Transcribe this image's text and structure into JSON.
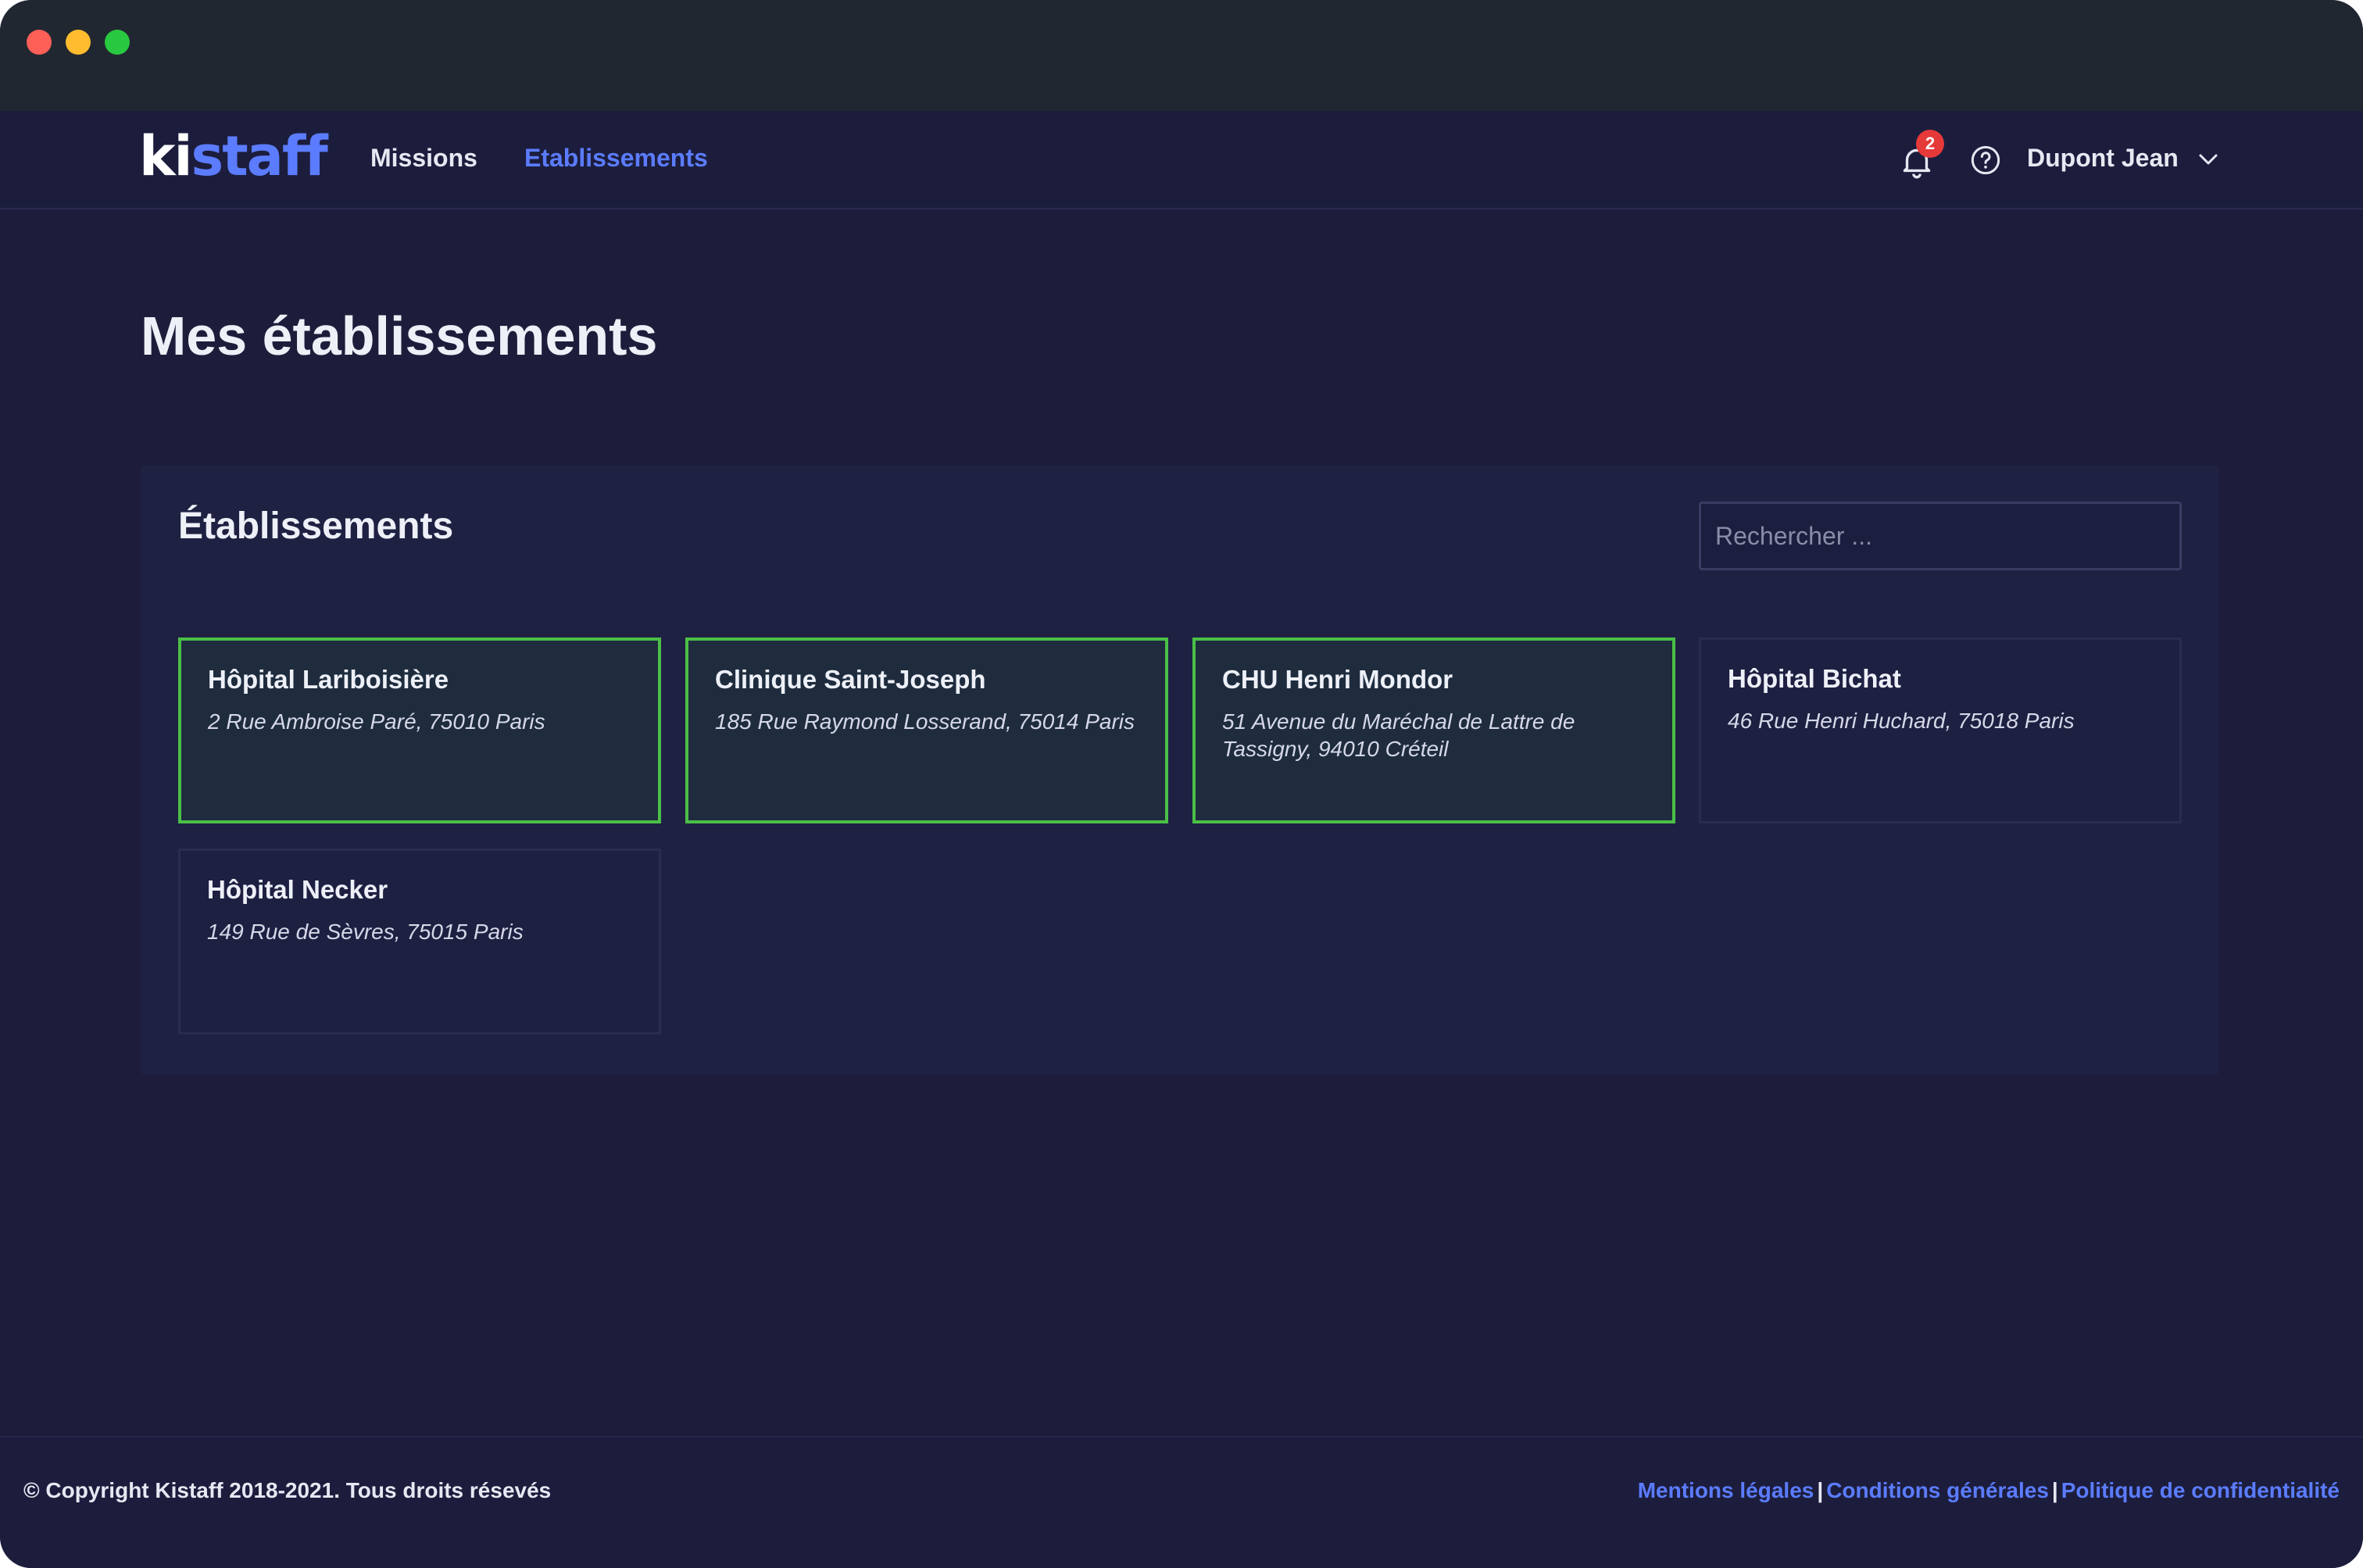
{
  "colors": {
    "accent": "#5b7cff",
    "selected_border": "#4bbf47",
    "badge": "#e5393a",
    "background": "#1d1d3b"
  },
  "brand": {
    "logo_part1": "ki",
    "logo_part2": "staff"
  },
  "nav": {
    "links": [
      {
        "label": "Missions",
        "active": false
      },
      {
        "label": "Etablissements",
        "active": true
      }
    ],
    "notifications": {
      "icon": "bell-icon",
      "count": "2"
    },
    "help_icon": "help-circle-icon",
    "user": {
      "name": "Dupont Jean",
      "icon": "chevron-down-icon"
    }
  },
  "page": {
    "title": "Mes établissements"
  },
  "panel": {
    "title": "Établissements",
    "search_placeholder": "Rechercher ...",
    "cards": [
      {
        "name": "Hôpital Lariboisière",
        "address": "2 Rue Ambroise Paré, 75010 Paris",
        "selected": true
      },
      {
        "name": "Clinique Saint-Joseph",
        "address": "185 Rue Raymond Losserand, 75014 Paris",
        "selected": true
      },
      {
        "name": "CHU Henri Mondor",
        "address": "51 Avenue du Maréchal de Lattre de Tassigny, 94010 Créteil",
        "selected": true
      },
      {
        "name": "Hôpital Bichat",
        "address": "46 Rue Henri Huchard, 75018 Paris",
        "selected": false
      },
      {
        "name": "Hôpital Necker",
        "address": "149 Rue de Sèvres, 75015 Paris",
        "selected": false
      }
    ]
  },
  "footer": {
    "copyright": "© Copyright Kistaff 2018-2021. Tous droits résevés",
    "links": [
      "Mentions légales",
      "Conditions générales",
      "Politique de confidentialité"
    ],
    "separator": "|"
  }
}
